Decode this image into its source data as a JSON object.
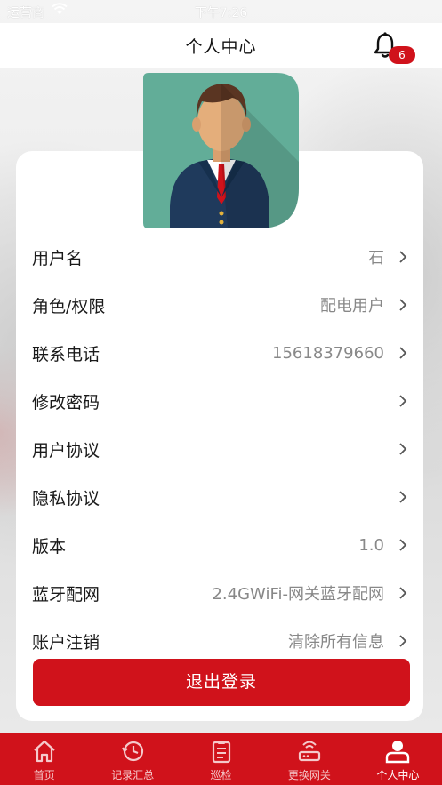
{
  "status_bar": {
    "carrier": "运营商",
    "time": "下午7:26"
  },
  "header": {
    "title": "个人中心",
    "notification_count": "6"
  },
  "profile_rows": [
    {
      "label": "用户名",
      "value": "石"
    },
    {
      "label": "角色/权限",
      "value": "配电用户"
    },
    {
      "label": "联系电话",
      "value": "15618379660"
    },
    {
      "label": "修改密码",
      "value": ""
    },
    {
      "label": "用户协议",
      "value": ""
    },
    {
      "label": "隐私协议",
      "value": ""
    },
    {
      "label": "版本",
      "value": "1.0"
    },
    {
      "label": "蓝牙配网",
      "value": "2.4GWiFi-网关蓝牙配网"
    },
    {
      "label": "账户注销",
      "value": "清除所有信息"
    }
  ],
  "logout_label": "退出登录",
  "tabbar": {
    "tabs": [
      {
        "label": "首页",
        "icon": "home-icon",
        "active": false
      },
      {
        "label": "记录汇总",
        "icon": "history-icon",
        "active": false
      },
      {
        "label": "巡检",
        "icon": "clipboard-icon",
        "active": false
      },
      {
        "label": "更换网关",
        "icon": "router-icon",
        "active": false
      },
      {
        "label": "个人中心",
        "icon": "user-icon",
        "active": true
      }
    ]
  },
  "colors": {
    "accent": "#d0121b",
    "avatar_bg": "#62ad98"
  }
}
